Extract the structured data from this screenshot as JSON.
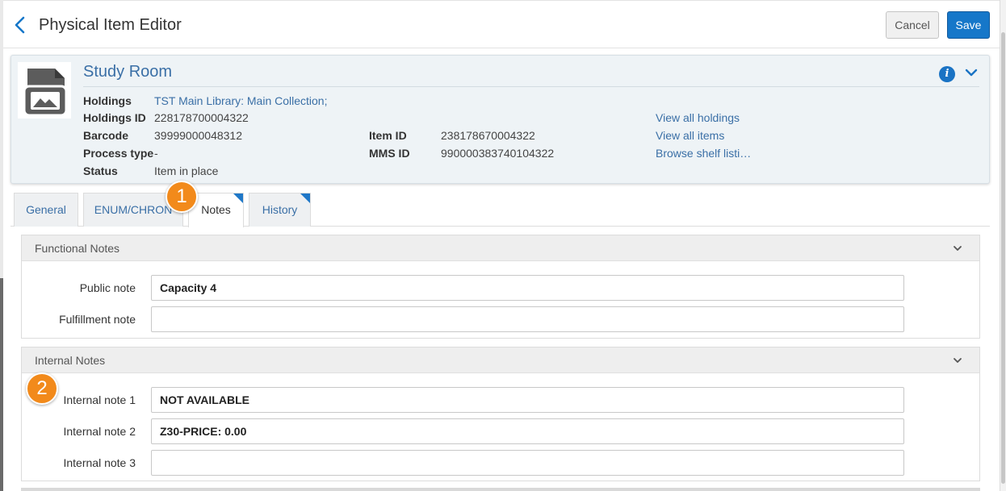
{
  "header": {
    "title": "Physical Item Editor",
    "cancel_label": "Cancel",
    "save_label": "Save",
    "accent": "#1677c9"
  },
  "record": {
    "title": "Study Room",
    "holdings_label": "Holdings",
    "holdings_value": "TST Main Library: Main Collection;",
    "holdings_id_label": "Holdings ID",
    "holdings_id_value": "228178700004322",
    "barcode_label": "Barcode",
    "barcode_value": "39999000048312",
    "process_type_label": "Process type",
    "process_type_value": "-",
    "status_label": "Status",
    "status_value": "Item in place",
    "item_id_label": "Item ID",
    "item_id_value": "238178670004322",
    "mms_id_label": "MMS ID",
    "mms_id_value": "990000383740104322",
    "links": [
      "View all holdings",
      "View all items",
      "Browse shelf listi…"
    ],
    "icons": [
      "image-placeholder-icon",
      "info-icon",
      "chevron-down-icon"
    ]
  },
  "tabs": [
    {
      "label": "General",
      "active": false
    },
    {
      "label": "ENUM/CHRON",
      "active": false
    },
    {
      "label": "Notes",
      "active": true
    },
    {
      "label": "History",
      "active": false
    }
  ],
  "callouts": [
    "1",
    "2"
  ],
  "functional_notes": {
    "title": "Functional Notes",
    "fields": [
      {
        "label": "Public note",
        "value": "Capacity 4"
      },
      {
        "label": "Fulfillment note",
        "value": ""
      }
    ]
  },
  "internal_notes": {
    "title": "Internal Notes",
    "fields": [
      {
        "label": "Internal note 1",
        "value": "NOT AVAILABLE"
      },
      {
        "label": "Internal note 2",
        "value": "Z30-PRICE: 0.00"
      },
      {
        "label": "Internal note 3",
        "value": ""
      }
    ]
  }
}
